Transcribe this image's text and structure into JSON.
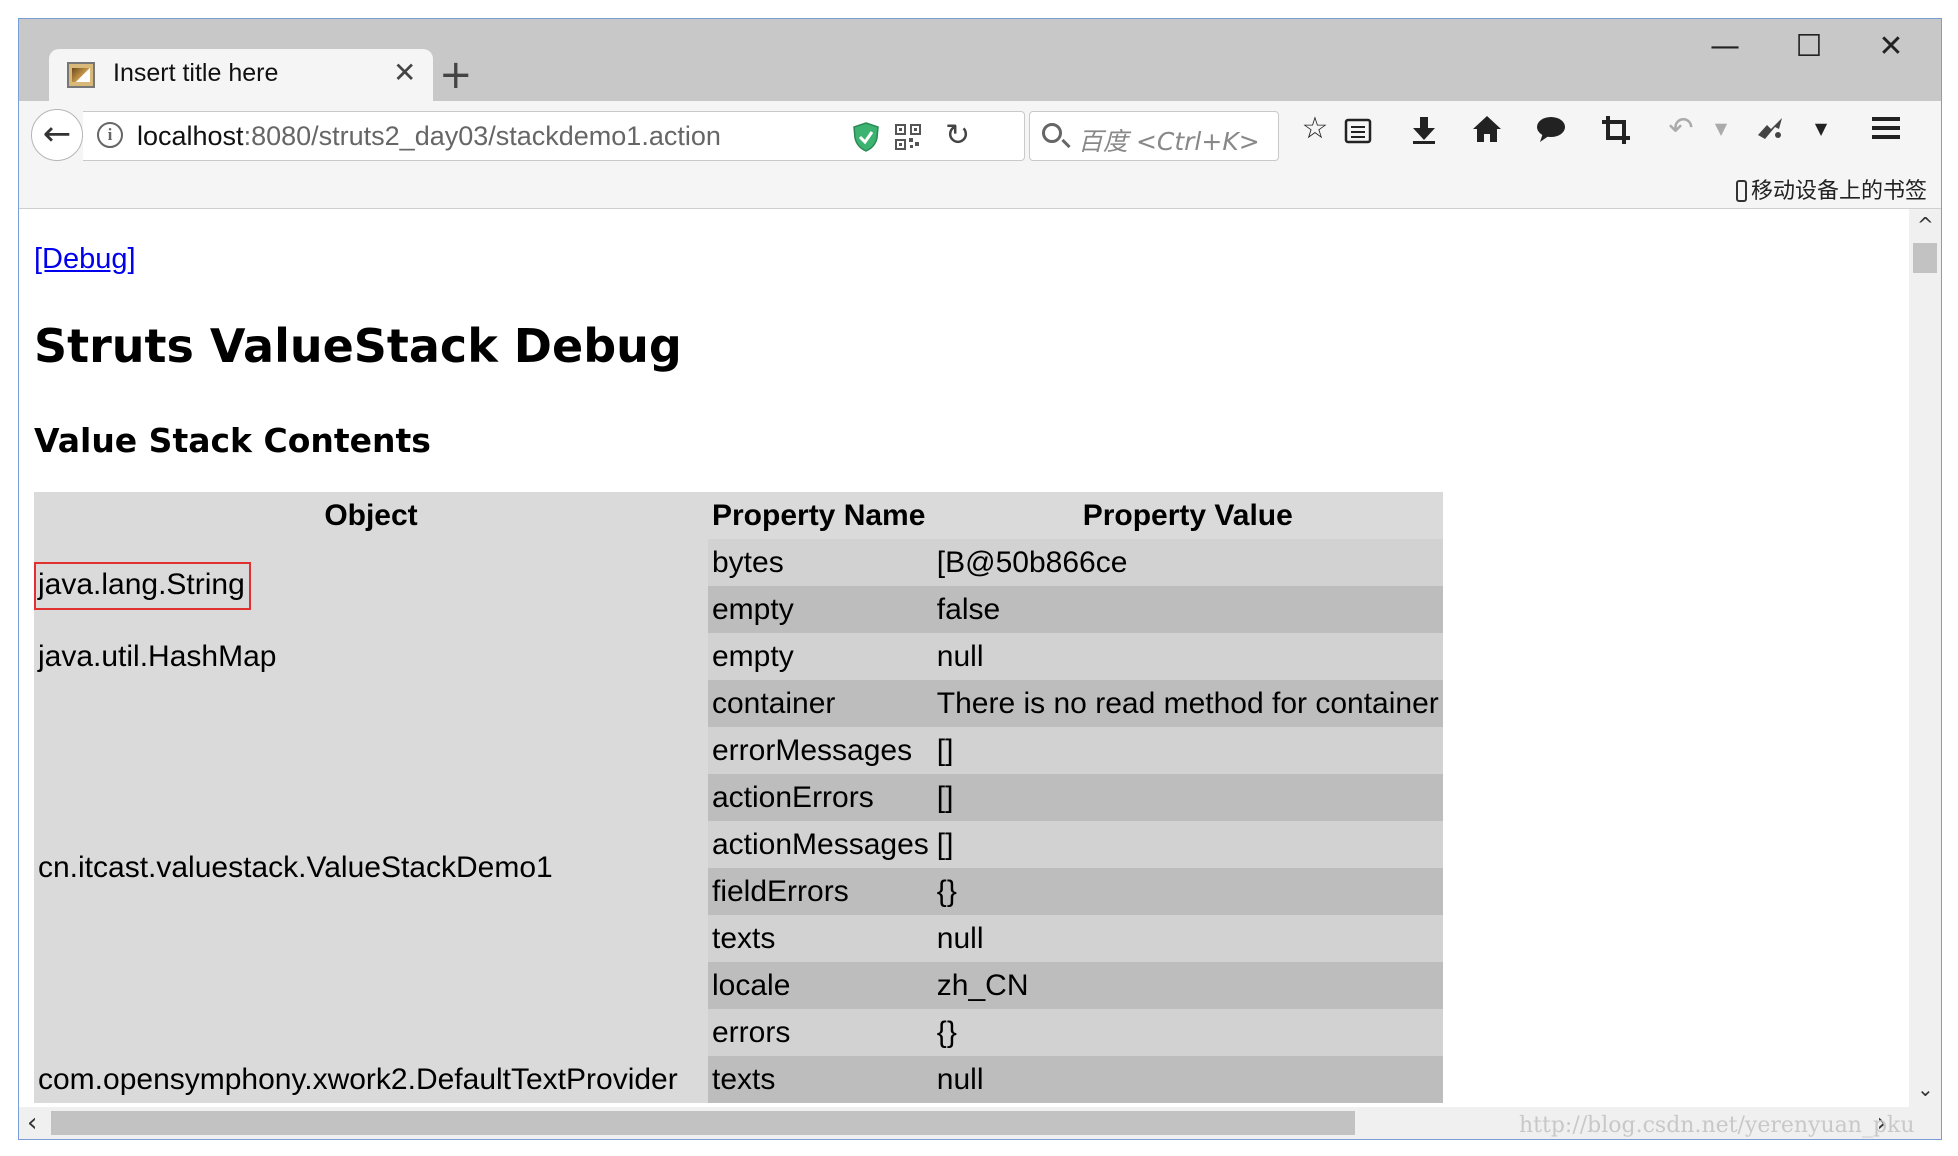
{
  "browser": {
    "tab_title": "Insert title here",
    "tab_close": "✕",
    "new_tab": "+",
    "window_controls": {
      "minimize": "—",
      "maximize": "☐",
      "close": "✕"
    },
    "url_host": "localhost",
    "url_path": ":8080/struts2_day03/stackdemo1.action",
    "search_placeholder": "百度 <Ctrl+K>",
    "mobile_bookmarks": "移动设备上的书签",
    "icons": [
      "back-arrow-icon",
      "info-icon",
      "shield-icon",
      "qr-code-icon",
      "reload-icon",
      "search-icon",
      "bookmark-star-icon",
      "reading-list-icon",
      "download-icon",
      "home-icon",
      "chat-icon",
      "crop-icon",
      "undo-icon",
      "extension-icon",
      "menu-icon"
    ],
    "accent_color": "#0000ee",
    "highlight_color": "#e03030"
  },
  "page": {
    "debug_link": "[Debug]",
    "title": "Struts ValueStack Debug",
    "subtitle": "Value Stack Contents",
    "table": {
      "headers": {
        "object": "Object",
        "property_name": "Property Name",
        "property_value": "Property Value"
      },
      "groups": [
        {
          "object": "java.lang.String",
          "highlighted": true,
          "rows": [
            {
              "name": "bytes",
              "value": "[B@50b866ce"
            },
            {
              "name": "empty",
              "value": "false"
            }
          ]
        },
        {
          "object": "java.util.HashMap",
          "rows": [
            {
              "name": "empty",
              "value": "null"
            }
          ]
        },
        {
          "object": "cn.itcast.valuestack.ValueStackDemo1",
          "rows": [
            {
              "name": "container",
              "value": "There is no read method for container"
            },
            {
              "name": "errorMessages",
              "value": "[]"
            },
            {
              "name": "actionErrors",
              "value": "[]"
            },
            {
              "name": "actionMessages",
              "value": "[]"
            },
            {
              "name": "fieldErrors",
              "value": "{}"
            },
            {
              "name": "texts",
              "value": "null"
            },
            {
              "name": "locale",
              "value": "zh_CN"
            },
            {
              "name": "errors",
              "value": "{}"
            }
          ]
        },
        {
          "object": "com.opensymphony.xwork2.DefaultTextProvider",
          "rows": [
            {
              "name": "texts",
              "value": "null"
            }
          ]
        }
      ]
    }
  },
  "watermark": "http://blog.csdn.net/yerenyuan_pku"
}
